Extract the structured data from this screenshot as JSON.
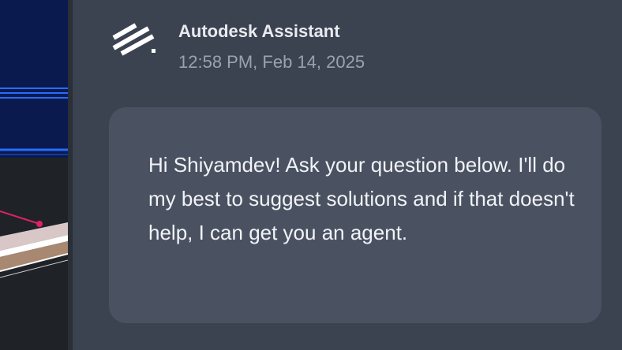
{
  "assistant": {
    "name": "Autodesk Assistant",
    "timestamp": "12:58 PM, Feb 14, 2025",
    "logo_icon": "autodesk-stripes-logo"
  },
  "message": {
    "text": "Hi Shiyamdev! Ask your question below. I'll do my best to suggest solutions and if that doesn't help, I can get you an agent."
  },
  "colors": {
    "panel_bg": "#3b4250",
    "bubble_bg": "#4a5262",
    "canvas_blue": "#0a1a4e",
    "accent_blue": "#2a6cff",
    "accent_magenta": "#e0206a"
  }
}
